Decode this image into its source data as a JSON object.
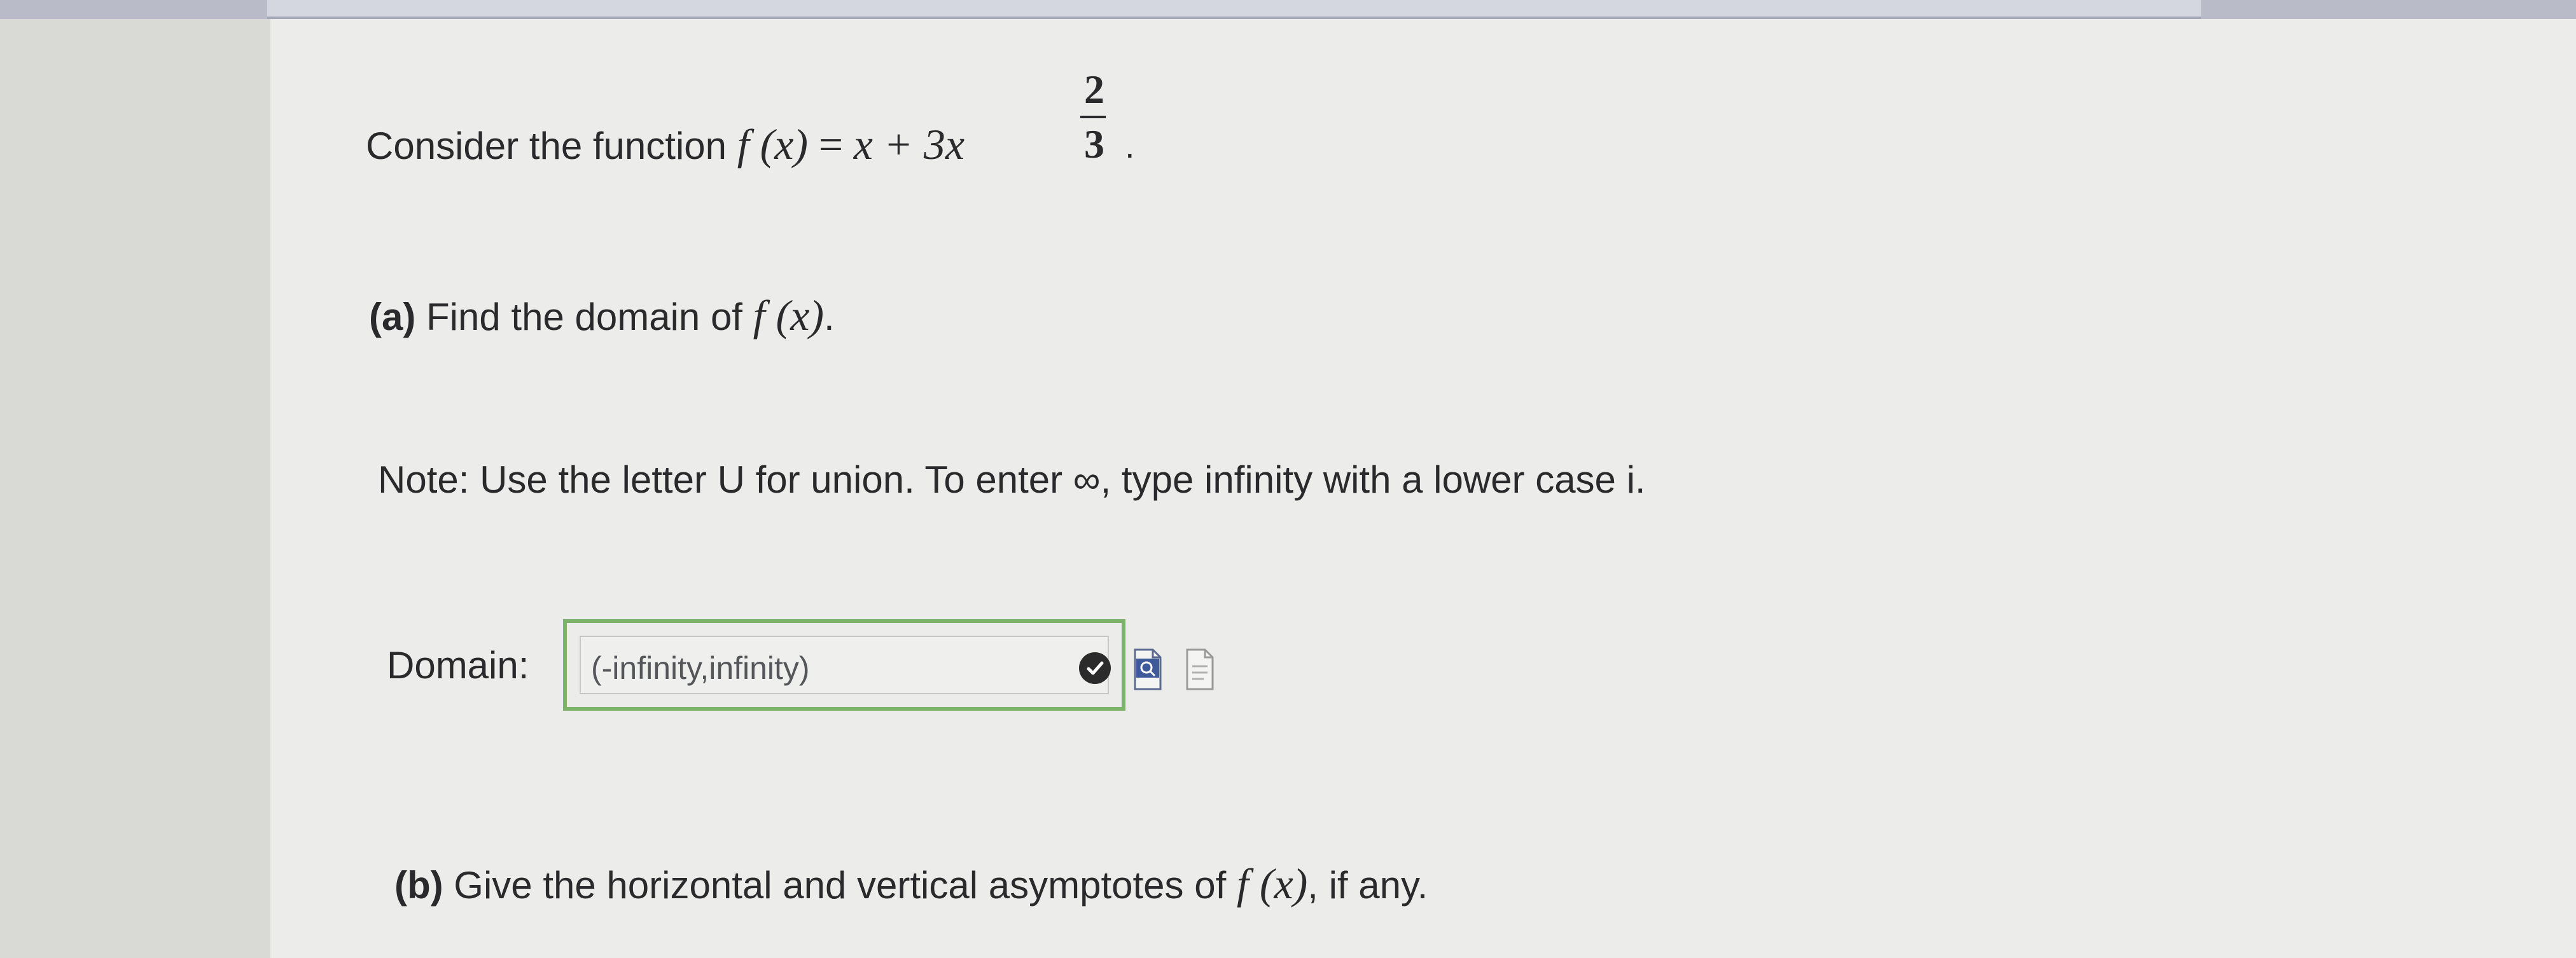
{
  "question": {
    "intro_text": "Consider the function",
    "function_lhs": "f (x)",
    "equals": "=",
    "function_rhs": "x + 3x",
    "exponent_numerator": "2",
    "exponent_denominator": "3",
    "trailing_period": "."
  },
  "part_a": {
    "label": "(a)",
    "prompt": "Find the domain of",
    "function_ref": "f (x)",
    "trailing_period": ".",
    "note": "Note: Use the letter U for union. To enter ∞, type infinity with a lower case i.",
    "field_label": "Domain:",
    "answer_value": "(-infinity,infinity)",
    "answer_status": "correct"
  },
  "part_b": {
    "label": "(b)",
    "prompt": "Give the horizontal and vertical asymptotes of",
    "function_ref": "f (x)",
    "suffix": ", if any."
  },
  "icons": {
    "status": "checkmark-icon",
    "preview": "preview-answer-icon",
    "history": "answer-history-icon"
  },
  "colors": {
    "correct_border": "#7cb26a",
    "text": "#2a2a2c"
  }
}
